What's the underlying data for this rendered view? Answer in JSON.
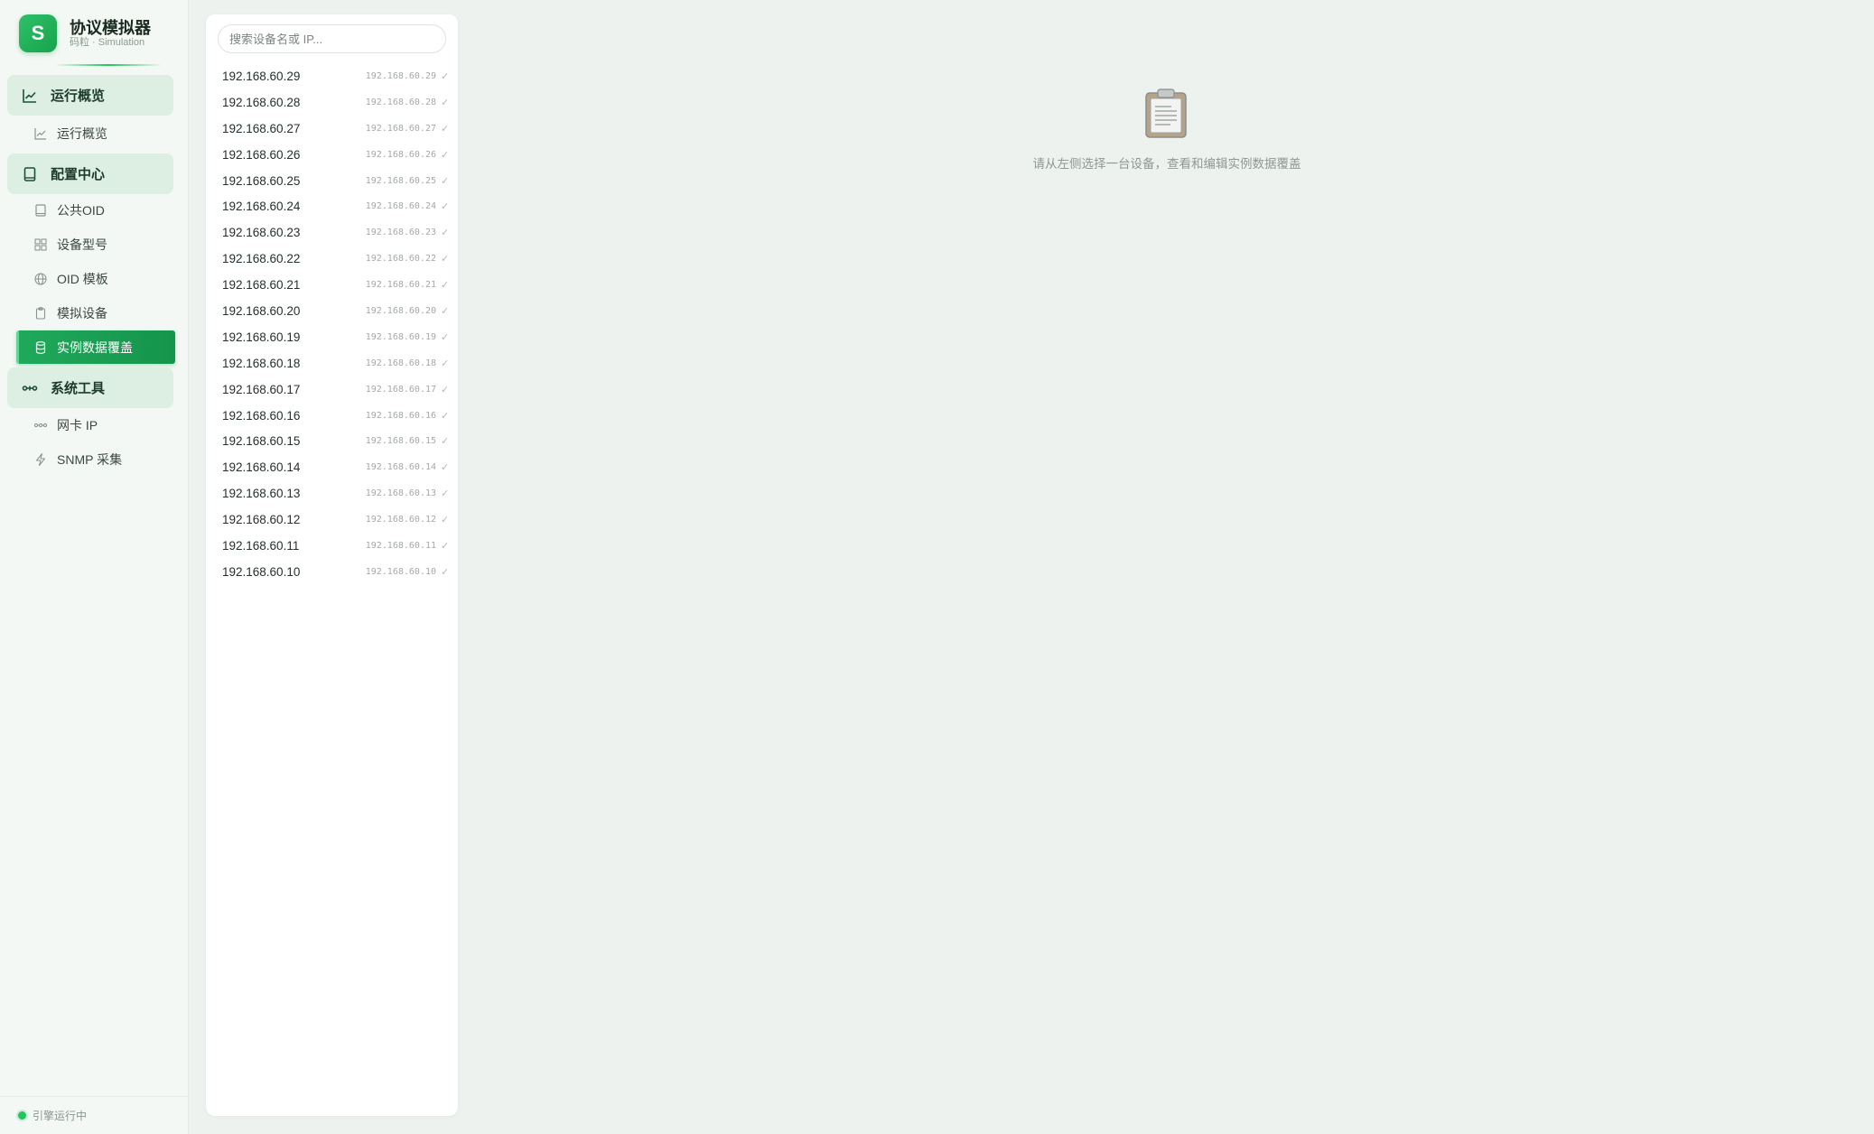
{
  "app": {
    "logo_letter": "S",
    "title": "协议模拟器",
    "subtitle": "码粒 · Simulation"
  },
  "sidebar": {
    "groups": [
      {
        "label": "运行概览",
        "icon": "line-chart-icon"
      },
      {
        "label": "配置中心",
        "icon": "book-icon"
      },
      {
        "label": "系统工具",
        "icon": "link-tool-icon"
      }
    ],
    "items": [
      {
        "label": "运行概览",
        "icon": "line-chart-icon"
      },
      {
        "label": "公共OID",
        "icon": "book-icon"
      },
      {
        "label": "设备型号",
        "icon": "grid-icon"
      },
      {
        "label": "OID 模板",
        "icon": "globe-icon"
      },
      {
        "label": "模拟设备",
        "icon": "clipboard-icon"
      },
      {
        "label": "实例数据覆盖",
        "icon": "database-icon",
        "active": true
      },
      {
        "label": "网卡 IP",
        "icon": "network-icon"
      },
      {
        "label": "SNMP 采集",
        "icon": "lightning-icon"
      }
    ],
    "footer_status": "引擎运行中"
  },
  "device_panel": {
    "search_placeholder": "搜索设备名或 IP...",
    "devices": [
      {
        "name": "192.168.60.29",
        "ip": "192.168.60.29",
        "check": "✓"
      },
      {
        "name": "192.168.60.28",
        "ip": "192.168.60.28",
        "check": "✓"
      },
      {
        "name": "192.168.60.27",
        "ip": "192.168.60.27",
        "check": "✓"
      },
      {
        "name": "192.168.60.26",
        "ip": "192.168.60.26",
        "check": "✓"
      },
      {
        "name": "192.168.60.25",
        "ip": "192.168.60.25",
        "check": "✓"
      },
      {
        "name": "192.168.60.24",
        "ip": "192.168.60.24",
        "check": "✓"
      },
      {
        "name": "192.168.60.23",
        "ip": "192.168.60.23",
        "check": "✓"
      },
      {
        "name": "192.168.60.22",
        "ip": "192.168.60.22",
        "check": "✓"
      },
      {
        "name": "192.168.60.21",
        "ip": "192.168.60.21",
        "check": "✓"
      },
      {
        "name": "192.168.60.20",
        "ip": "192.168.60.20",
        "check": "✓"
      },
      {
        "name": "192.168.60.19",
        "ip": "192.168.60.19",
        "check": "✓"
      },
      {
        "name": "192.168.60.18",
        "ip": "192.168.60.18",
        "check": "✓"
      },
      {
        "name": "192.168.60.17",
        "ip": "192.168.60.17",
        "check": "✓"
      },
      {
        "name": "192.168.60.16",
        "ip": "192.168.60.16",
        "check": "✓"
      },
      {
        "name": "192.168.60.15",
        "ip": "192.168.60.15",
        "check": "✓"
      },
      {
        "name": "192.168.60.14",
        "ip": "192.168.60.14",
        "check": "✓"
      },
      {
        "name": "192.168.60.13",
        "ip": "192.168.60.13",
        "check": "✓"
      },
      {
        "name": "192.168.60.12",
        "ip": "192.168.60.12",
        "check": "✓"
      },
      {
        "name": "192.168.60.11",
        "ip": "192.168.60.11",
        "check": "✓"
      },
      {
        "name": "192.168.60.10",
        "ip": "192.168.60.10",
        "check": "✓"
      }
    ]
  },
  "main": {
    "empty_icon": "clipboard-icon",
    "empty_message": "请从左侧选择一台设备，查看和编辑实例数据覆盖"
  },
  "colors": {
    "accent": "#16a34a",
    "active_item_bg": "#1fa95b",
    "group_header_bg": "#dcefe2",
    "status_ok": "#22c55e"
  }
}
